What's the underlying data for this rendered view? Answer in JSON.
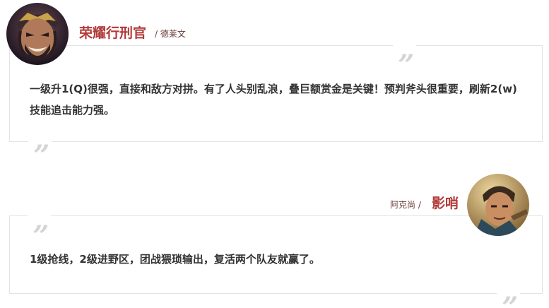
{
  "entries": [
    {
      "name": "荣耀行刑官",
      "role": "/ 德莱文",
      "text": "一级升1(Q)很强，直接和敌方对拼。有了人头别乱浪，叠巨额赏金是关键！预判斧头很重要，刷新2(w)技能追击能力强。",
      "avatar_icon": "draven-portrait",
      "quote_icon": "quote-marks"
    },
    {
      "name": "影哨",
      "role": "阿克尚 /",
      "text": "1级抢线，2级进野区，团战猥琐输出，复活两个队友就赢了。",
      "avatar_icon": "akshan-portrait",
      "quote_icon": "quote-marks"
    }
  ],
  "colors": {
    "accent": "#b23a3a",
    "border": "#e3e3e3",
    "quote": "#d4d4d4",
    "text": "#333333"
  }
}
